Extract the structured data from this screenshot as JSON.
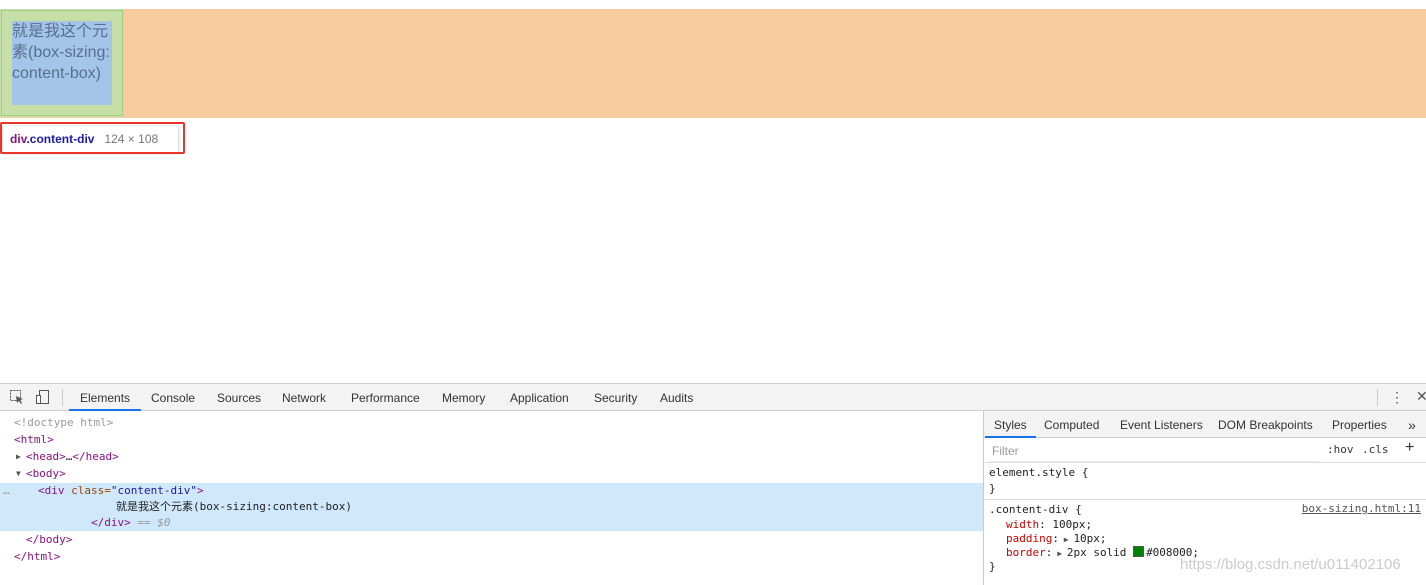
{
  "viewport": {
    "element_text": "就是我这个元素(box-sizing:content-box)",
    "tooltip": {
      "tag": "div",
      "class": ".content-div",
      "dims": "124 × 108"
    }
  },
  "devtools": {
    "tabs": [
      "Elements",
      "Console",
      "Sources",
      "Network",
      "Performance",
      "Memory",
      "Application",
      "Security",
      "Audits"
    ],
    "active_tab": "Elements",
    "dom": {
      "doctype": "<!doctype html>",
      "html_open": "<html>",
      "head_open": "<head>",
      "ellipsis": "…",
      "head_close": "</head>",
      "body_open": "<body>",
      "div_tag_open": "<div ",
      "div_attr_name": "class=",
      "div_attr_value": "\"content-div\"",
      "div_tag_end": ">",
      "div_text": "就是我这个元素(box-sizing:content-box)",
      "div_close": "</div>",
      "selected_marker": " == $0",
      "body_close": "</body>",
      "html_close": "</html>",
      "gutter_dots": "…"
    },
    "side_tabs": [
      "Styles",
      "Computed",
      "Event Listeners",
      "DOM Breakpoints",
      "Properties"
    ],
    "side_more": "»",
    "filter_placeholder": "Filter",
    "hov": ":hov",
    "cls": ".cls",
    "plus": "+",
    "rules": {
      "element_style_selector": "element.style {",
      "close_brace": "}",
      "content_div_selector": ".content-div {",
      "source_link": "box-sizing.html:11",
      "width_prop": "width",
      "width_val": "100px;",
      "padding_prop": "padding",
      "padding_val": "10px;",
      "border_prop": "border",
      "border_val_1": "2px solid ",
      "border_val_2": "#008000;",
      "swatch_color": "#008000"
    },
    "menu_dots": "⋮",
    "close": "✕"
  },
  "watermark": "https://blog.csdn.net/u011402106",
  "colors": {
    "margin_orange": "#f8cc9e",
    "padding_green": "#c6dfa7",
    "content_blue": "#a4c4e8",
    "highlight_red": "#e8342a",
    "accent_blue": "#1a73e8"
  }
}
